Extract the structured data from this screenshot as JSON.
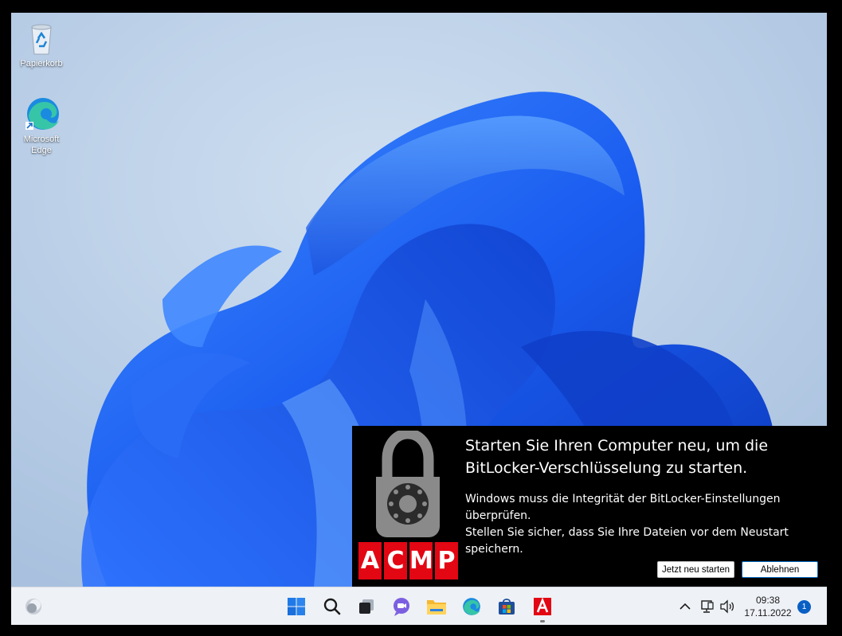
{
  "desktop": {
    "icons": [
      {
        "label": "Papierkorb",
        "icon": "recycle-bin-icon"
      },
      {
        "label": "Microsoft Edge",
        "icon": "edge-icon"
      }
    ]
  },
  "toast": {
    "title": "Starten Sie Ihren Computer neu, um die\nBitLocker-Verschlüsselung zu starten.",
    "body": "Windows muss die Integrität der BitLocker-Einstellungen\nüberprüfen.\nStellen Sie sicher, dass Sie Ihre Dateien vor dem Neustart speichern.",
    "brand_letters": [
      "A",
      "C",
      "M",
      "P"
    ],
    "brand_color": "#e30613",
    "buttons": {
      "restart": "Jetzt neu starten",
      "decline": "Ablehnen"
    }
  },
  "taskbar": {
    "apps": [
      "weather-widget-icon",
      "start-icon",
      "search-icon",
      "task-view-icon",
      "teams-chat-icon",
      "file-explorer-icon",
      "edge-icon",
      "store-icon",
      "acmp-icon"
    ],
    "clock": {
      "time": "09:38",
      "date": "17.11.2022"
    },
    "notifications": "1",
    "accent_color": "#0a5fc4"
  }
}
